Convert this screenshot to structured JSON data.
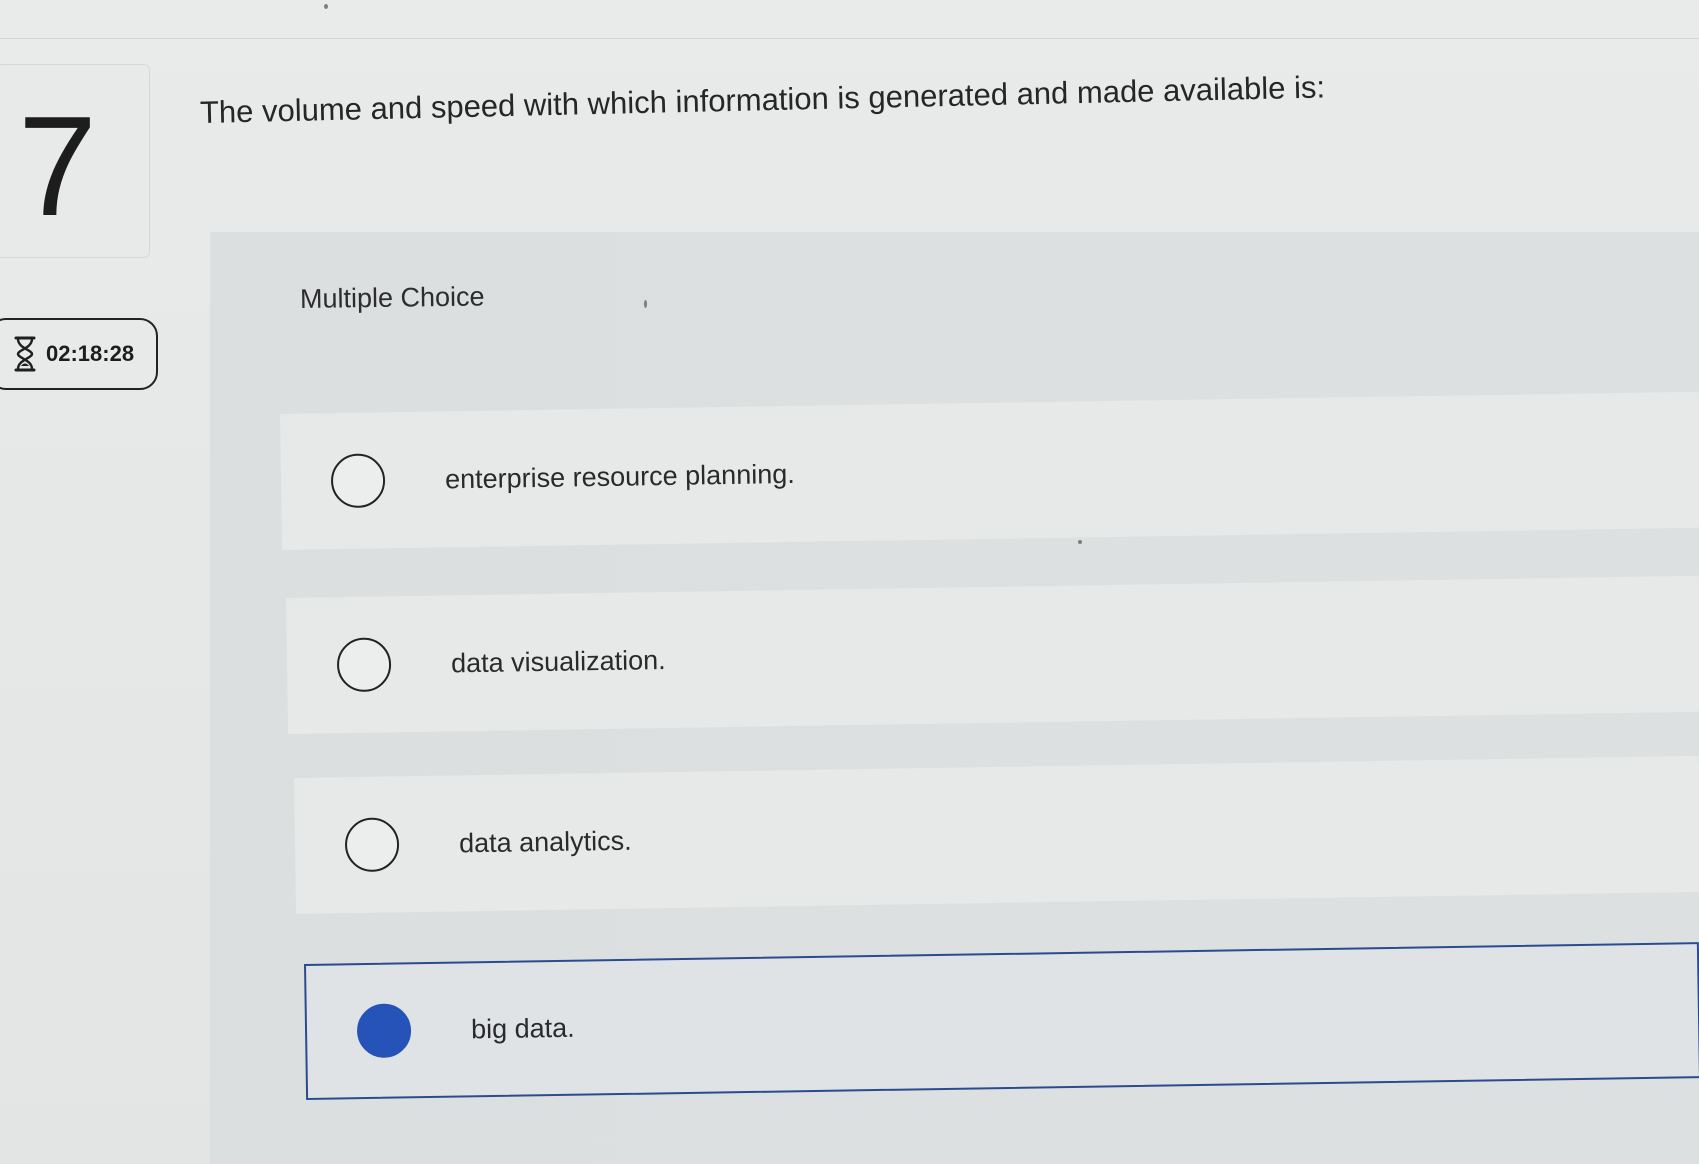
{
  "question": {
    "number": "7",
    "text": "The volume and speed with which information is generated and made available is:"
  },
  "timer": {
    "icon": "hourglass-icon",
    "value": "02:18:28"
  },
  "choice_panel": {
    "type_label": "Multiple Choice",
    "options": [
      {
        "label": "enterprise resource planning.",
        "selected": false
      },
      {
        "label": "data visualization.",
        "selected": false
      },
      {
        "label": "data analytics.",
        "selected": false
      },
      {
        "label": "big data.",
        "selected": true
      }
    ]
  },
  "colors": {
    "selected_radio": "#2553b8",
    "selected_border": "#2a4c8e"
  }
}
